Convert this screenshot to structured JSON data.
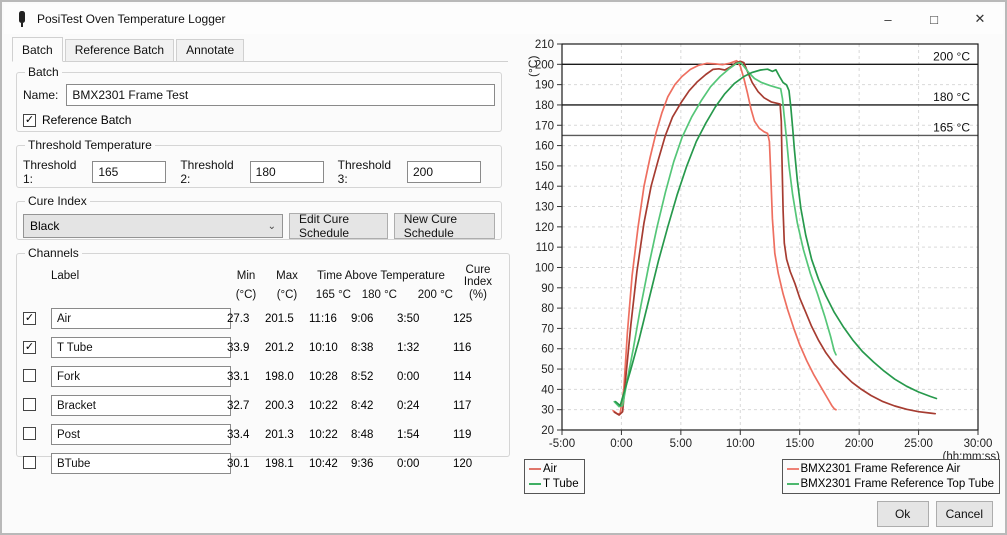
{
  "window": {
    "title": "PosiTest Oven Temperature Logger",
    "controls": {
      "minimize": "–",
      "maximize": "□",
      "close": "✕"
    }
  },
  "tabs": [
    {
      "label": "Batch",
      "active": true
    },
    {
      "label": "Reference Batch",
      "active": false
    },
    {
      "label": "Annotate",
      "active": false
    }
  ],
  "batch": {
    "group_label": "Batch",
    "name_label": "Name:",
    "name_value": "BMX2301 Frame Test",
    "reference_checkbox_label": "Reference Batch",
    "reference_checked": true,
    "checkmark": "✓"
  },
  "thresholds": {
    "group_label": "Threshold Temperature",
    "fields": [
      {
        "label": "Threshold 1:",
        "value": "165"
      },
      {
        "label": "Threshold 2:",
        "value": "180"
      },
      {
        "label": "Threshold 3:",
        "value": "200"
      }
    ]
  },
  "cure_index": {
    "group_label": "Cure Index",
    "selected": "Black",
    "chevron": "⌄",
    "edit_button": "Edit Cure Schedule",
    "new_button": "New Cure Schedule"
  },
  "channels": {
    "group_label": "Channels",
    "header": {
      "label": "Label",
      "min": "Min",
      "max": "Max",
      "time_above": "Time Above Temperature",
      "cure": "Cure Index",
      "min_unit": "(°C)",
      "max_unit": "(°C)",
      "t1": "165 °C",
      "t2": "180 °C",
      "t3": "200 °C",
      "cure_unit": "(%)"
    },
    "rows": [
      {
        "checked": true,
        "label": "Air",
        "min": "27.3",
        "max": "201.5",
        "t165": "11:16",
        "t180": "9:06",
        "t200": "3:50",
        "cure": "125"
      },
      {
        "checked": true,
        "label": "T Tube",
        "min": "33.9",
        "max": "201.2",
        "t165": "10:10",
        "t180": "8:38",
        "t200": "1:32",
        "cure": "116"
      },
      {
        "checked": false,
        "label": "Fork",
        "min": "33.1",
        "max": "198.0",
        "t165": "10:28",
        "t180": "8:52",
        "t200": "0:00",
        "cure": "114"
      },
      {
        "checked": false,
        "label": "Bracket",
        "min": "32.7",
        "max": "200.3",
        "t165": "10:22",
        "t180": "8:42",
        "t200": "0:24",
        "cure": "117"
      },
      {
        "checked": false,
        "label": "Post",
        "min": "33.4",
        "max": "201.3",
        "t165": "10:22",
        "t180": "8:48",
        "t200": "1:54",
        "cure": "119"
      },
      {
        "checked": false,
        "label": "BTube",
        "min": "30.1",
        "max": "198.1",
        "t165": "10:42",
        "t180": "9:36",
        "t200": "0:00",
        "cure": "120"
      }
    ]
  },
  "footer": {
    "ok": "Ok",
    "cancel": "Cancel"
  },
  "chart_data": {
    "type": "line",
    "ylabel": "(°C)",
    "xlabel": "(hh:mm:ss)",
    "ylim": [
      20,
      210
    ],
    "xlim_minutes": [
      -5,
      30
    ],
    "grid": "dashed",
    "y_ticks": [
      20,
      30,
      40,
      50,
      60,
      70,
      80,
      90,
      100,
      110,
      120,
      130,
      140,
      150,
      160,
      170,
      180,
      190,
      200,
      210
    ],
    "x_ticks": [
      {
        "minutes": -5,
        "label": "-5:00"
      },
      {
        "minutes": 0,
        "label": "0:00"
      },
      {
        "minutes": 5,
        "label": "5:00"
      },
      {
        "minutes": 10,
        "label": "10:00"
      },
      {
        "minutes": 15,
        "label": "15:00"
      },
      {
        "minutes": 20,
        "label": "20:00"
      },
      {
        "minutes": 25,
        "label": "25:00"
      },
      {
        "minutes": 30,
        "label": "30:00"
      }
    ],
    "threshold_lines": [
      {
        "value": 200,
        "label": "200 °C",
        "color": "#1a1a1a"
      },
      {
        "value": 180,
        "label": "180 °C",
        "color": "#1a1a1a"
      },
      {
        "value": 165,
        "label": "165 °C",
        "color": "#5a5a5a"
      }
    ],
    "legend_left": [
      {
        "name": "Air",
        "color": "#e0756a"
      },
      {
        "name": "T Tube",
        "color": "#3fae63"
      }
    ],
    "legend_right": [
      {
        "name": "BMX2301 Frame Reference Air",
        "color": "#ee8176"
      },
      {
        "name": "BMX2301 Frame Reference Top Tube",
        "color": "#4db86e"
      }
    ],
    "series": [
      {
        "name": "BMX2301 Frame Reference Air",
        "color": "#ee6f60",
        "points": [
          [
            -0.7,
            29.5
          ],
          [
            -0.3,
            27.8
          ],
          [
            -0.1,
            28.2
          ],
          [
            0.2,
            40
          ],
          [
            0.5,
            68
          ],
          [
            0.9,
            96
          ],
          [
            1.4,
            120
          ],
          [
            1.9,
            140
          ],
          [
            2.4,
            154
          ],
          [
            2.9,
            166
          ],
          [
            3.4,
            176
          ],
          [
            3.9,
            184
          ],
          [
            4.5,
            190
          ],
          [
            5.1,
            194
          ],
          [
            5.8,
            197.5
          ],
          [
            6.5,
            199.5
          ],
          [
            7.2,
            200.5
          ],
          [
            7.9,
            200.2
          ],
          [
            8.5,
            199.8
          ],
          [
            9.1,
            200.5
          ],
          [
            9.7,
            201.8
          ],
          [
            10,
            199
          ],
          [
            10.3,
            193
          ],
          [
            10.6,
            186
          ],
          [
            10.9,
            178
          ],
          [
            11.2,
            172
          ],
          [
            11.6,
            168.5
          ],
          [
            12,
            166.8
          ],
          [
            12.3,
            166
          ],
          [
            12.45,
            162
          ],
          [
            12.55,
            148
          ],
          [
            12.7,
            124
          ],
          [
            12.9,
            107
          ],
          [
            13.2,
            97
          ],
          [
            13.6,
            87
          ],
          [
            14,
            79
          ],
          [
            14.5,
            70
          ],
          [
            15,
            62
          ],
          [
            15.6,
            54
          ],
          [
            16.2,
            47
          ],
          [
            16.8,
            41
          ],
          [
            17.3,
            36
          ],
          [
            17.7,
            32
          ],
          [
            17.9,
            30.5
          ],
          [
            18.05,
            30
          ]
        ]
      },
      {
        "name": "Air",
        "color": "#a63c31",
        "points": [
          [
            -0.6,
            28.8
          ],
          [
            -0.2,
            27.4
          ],
          [
            0.1,
            29
          ],
          [
            0.4,
            48
          ],
          [
            0.8,
            72
          ],
          [
            1.3,
            98
          ],
          [
            1.9,
            122
          ],
          [
            2.5,
            140
          ],
          [
            3.1,
            153
          ],
          [
            3.7,
            165
          ],
          [
            4.3,
            174
          ],
          [
            5,
            181
          ],
          [
            5.7,
            187
          ],
          [
            6.4,
            191.5
          ],
          [
            7.1,
            195
          ],
          [
            7.7,
            197.5
          ],
          [
            8.2,
            197.8
          ],
          [
            8.7,
            197.2
          ],
          [
            9.2,
            198.8
          ],
          [
            9.6,
            200.6
          ],
          [
            10,
            201.5
          ],
          [
            10.3,
            200.8
          ],
          [
            10.6,
            196.5
          ],
          [
            11,
            191
          ],
          [
            11.5,
            186.5
          ],
          [
            12,
            183.5
          ],
          [
            12.6,
            181.5
          ],
          [
            13.1,
            180.8
          ],
          [
            13.35,
            180.4
          ],
          [
            13.45,
            172
          ],
          [
            13.5,
            155
          ],
          [
            13.6,
            128
          ],
          [
            13.7,
            112
          ],
          [
            13.9,
            104
          ],
          [
            14.2,
            98
          ],
          [
            14.6,
            92
          ],
          [
            15,
            85
          ],
          [
            15.5,
            78
          ],
          [
            16,
            71
          ],
          [
            16.6,
            64
          ],
          [
            17.2,
            58
          ],
          [
            17.9,
            52.5
          ],
          [
            18.6,
            48
          ],
          [
            19.4,
            43.5
          ],
          [
            20.2,
            40
          ],
          [
            21,
            37
          ],
          [
            22,
            34
          ],
          [
            23,
            31.8
          ],
          [
            24,
            30.2
          ],
          [
            25,
            29
          ],
          [
            26,
            28.3
          ],
          [
            26.4,
            28
          ]
        ]
      },
      {
        "name": "BMX2301 Frame Reference Top Tube",
        "color": "#55c678",
        "points": [
          [
            -0.6,
            34
          ],
          [
            -0.2,
            31.5
          ],
          [
            0.1,
            32
          ],
          [
            0.5,
            45
          ],
          [
            1,
            60
          ],
          [
            1.6,
            80
          ],
          [
            2.3,
            101
          ],
          [
            3,
            120
          ],
          [
            3.7,
            137
          ],
          [
            4.4,
            152
          ],
          [
            5.1,
            164
          ],
          [
            5.9,
            174
          ],
          [
            6.7,
            182
          ],
          [
            7.5,
            189
          ],
          [
            8.3,
            194
          ],
          [
            9.1,
            198
          ],
          [
            9.7,
            200.5
          ],
          [
            10,
            200.9
          ],
          [
            10.3,
            199
          ],
          [
            10.7,
            196
          ],
          [
            11.2,
            193
          ],
          [
            11.8,
            191
          ],
          [
            12.5,
            189.5
          ],
          [
            13.1,
            188.5
          ],
          [
            13.4,
            188
          ],
          [
            13.55,
            183
          ],
          [
            13.7,
            174
          ],
          [
            13.9,
            163
          ],
          [
            14.1,
            150
          ],
          [
            14.4,
            136
          ],
          [
            14.8,
            122
          ],
          [
            15.3,
            109
          ],
          [
            15.9,
            97
          ],
          [
            16.5,
            87
          ],
          [
            17.1,
            76
          ],
          [
            17.6,
            66
          ],
          [
            17.9,
            59
          ],
          [
            18.05,
            57
          ]
        ]
      },
      {
        "name": "T Tube",
        "color": "#27994c",
        "points": [
          [
            -0.5,
            34
          ],
          [
            -0.1,
            32
          ],
          [
            0.3,
            40
          ],
          [
            0.8,
            50
          ],
          [
            1.5,
            65
          ],
          [
            2.3,
            84
          ],
          [
            3.1,
            103
          ],
          [
            3.9,
            120
          ],
          [
            4.7,
            136
          ],
          [
            5.5,
            150
          ],
          [
            6.3,
            162
          ],
          [
            7.1,
            171
          ],
          [
            7.9,
            179
          ],
          [
            8.7,
            185.5
          ],
          [
            9.5,
            190.5
          ],
          [
            10.3,
            194
          ],
          [
            11,
            196
          ],
          [
            11.7,
            197.2
          ],
          [
            12.3,
            197.6
          ],
          [
            12.7,
            196.5
          ],
          [
            13,
            197.3
          ],
          [
            13.3,
            194
          ],
          [
            13.6,
            191
          ],
          [
            13.9,
            189.8
          ],
          [
            14.1,
            187
          ],
          [
            14.25,
            179
          ],
          [
            14.4,
            169
          ],
          [
            14.55,
            158
          ],
          [
            14.8,
            143
          ],
          [
            15.1,
            129
          ],
          [
            15.5,
            116
          ],
          [
            16,
            104
          ],
          [
            16.6,
            94
          ],
          [
            17.2,
            86
          ],
          [
            17.9,
            78
          ],
          [
            18.7,
            70.5
          ],
          [
            19.5,
            64
          ],
          [
            20.3,
            58.5
          ],
          [
            21.2,
            53.5
          ],
          [
            22.1,
            49
          ],
          [
            23,
            45
          ],
          [
            24,
            41.5
          ],
          [
            25,
            38.7
          ],
          [
            26,
            36.5
          ],
          [
            26.5,
            35.5
          ]
        ]
      }
    ]
  }
}
